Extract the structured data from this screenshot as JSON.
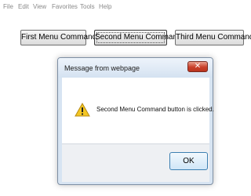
{
  "menubar": {
    "items": [
      "File",
      "Edit",
      "View",
      "Favorites",
      "Tools",
      "Help"
    ]
  },
  "toolbar": {
    "buttons": [
      "First Menu Command",
      "Second Menu Command",
      "Third Menu Command"
    ]
  },
  "dialog": {
    "title": "Message from webpage",
    "close_label": "✕",
    "icon": "warning-icon",
    "message": "Second Menu Command button is clicked.",
    "ok_label": "OK"
  }
}
